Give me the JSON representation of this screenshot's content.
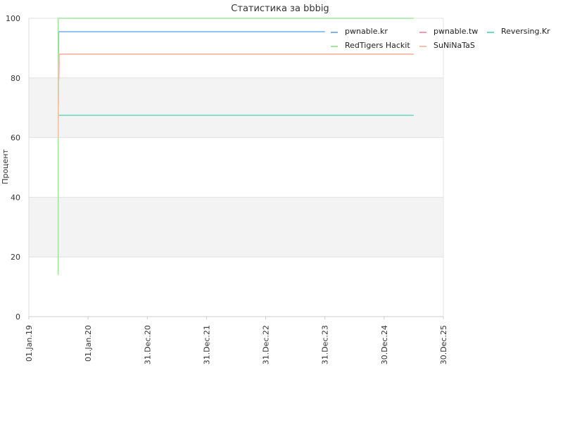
{
  "chart_data": {
    "type": "line",
    "title": "Статистика за bbbig",
    "xlabel": "",
    "ylabel": "Процент",
    "ylim": [
      0,
      100
    ],
    "yticks": [
      0,
      20,
      40,
      60,
      80,
      100
    ],
    "xlim": [
      "2019-01-01",
      "2025-12-30"
    ],
    "xticks": [
      {
        "date": "2019-01-01",
        "label": "01.Jan.19"
      },
      {
        "date": "2020-01-01",
        "label": "01.Jan.20"
      },
      {
        "date": "2020-12-31",
        "label": "31.Dec.20"
      },
      {
        "date": "2021-12-31",
        "label": "31.Dec.21"
      },
      {
        "date": "2022-12-31",
        "label": "31.Dec.22"
      },
      {
        "date": "2023-12-31",
        "label": "31.Dec.23"
      },
      {
        "date": "2024-12-30",
        "label": "30.Dec.24"
      },
      {
        "date": "2025-12-30",
        "label": "30.Dec.25"
      }
    ],
    "grid": {
      "horizontal": true,
      "alternating_bands": true
    },
    "legend_position": "top-right",
    "series": [
      {
        "name": "pwnable.kr",
        "color": "#7fb2f0",
        "points": [
          [
            "2019-07-02",
            83.0
          ],
          [
            "2019-07-04",
            95.5
          ],
          [
            "2023-12-31",
            95.5
          ]
        ]
      },
      {
        "name": "pwnable.tw",
        "color": "#f29ab1",
        "points": [
          [
            "2019-07-02",
            71.0
          ],
          [
            "2019-07-03",
            79.0
          ],
          [
            "2019-07-05",
            80.0
          ],
          [
            "2019-07-07",
            88.0
          ],
          [
            "2025-06-30",
            88.0
          ]
        ]
      },
      {
        "name": "Reversing.Kr",
        "color": "#6fdcbf",
        "points": [
          [
            "2019-07-01",
            67.5
          ],
          [
            "2025-06-30",
            67.5
          ]
        ]
      },
      {
        "name": "RedTigers Hackit",
        "color": "#9ee89c",
        "points": [
          [
            "2019-07-01",
            14.0
          ],
          [
            "2019-07-01",
            100.0
          ],
          [
            "2025-06-30",
            100.0
          ]
        ]
      },
      {
        "name": "SuNiNaTaS",
        "color": "#f5c0a8",
        "points": [
          [
            "2019-07-01",
            60.0
          ],
          [
            "2019-07-03",
            85.0
          ],
          [
            "2019-07-07",
            88.0
          ],
          [
            "2025-06-30",
            88.0
          ]
        ]
      }
    ]
  }
}
